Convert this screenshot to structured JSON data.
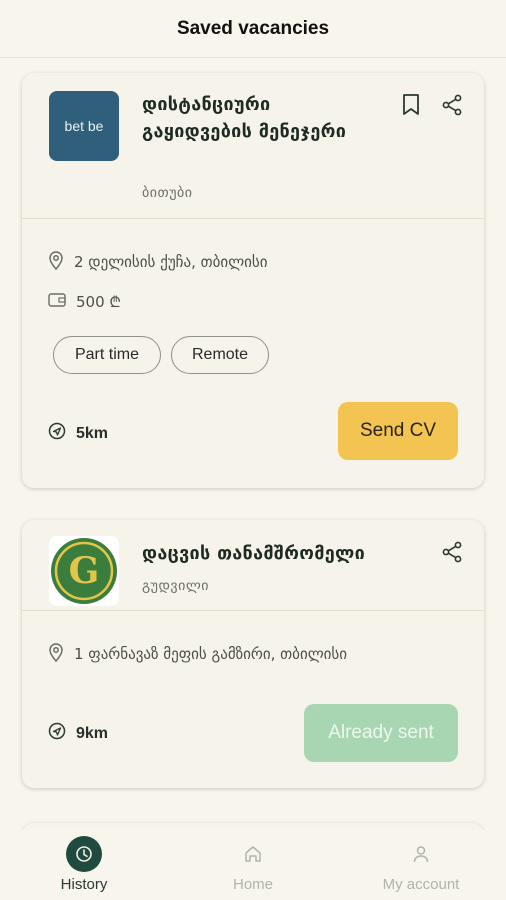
{
  "header": {
    "title": "Saved vacancies"
  },
  "vacancies": [
    {
      "title": "დისტანციური გაყიდვების მენეჯერი",
      "company": "ბითუბი",
      "logo_text": "bet be",
      "address": "2 დელისის ქუჩა, თბილისი",
      "salary": "500 ₾",
      "tags": [
        "Part time",
        "Remote"
      ],
      "distance": "5km",
      "action": "Send CV"
    },
    {
      "title": "დაცვის თანამშრომელი",
      "company": "გუდვილი",
      "logo_text": "G",
      "address": "1 ფარნავაზ მეფის გამზირი, თბილისი",
      "distance": "9km",
      "action": "Already sent"
    }
  ],
  "nav": {
    "history": "History",
    "home": "Home",
    "account": "My account"
  },
  "colors": {
    "accent_yellow": "#f4c452",
    "sent_green": "#a9d6b2",
    "active_nav": "#1e4a3f"
  }
}
